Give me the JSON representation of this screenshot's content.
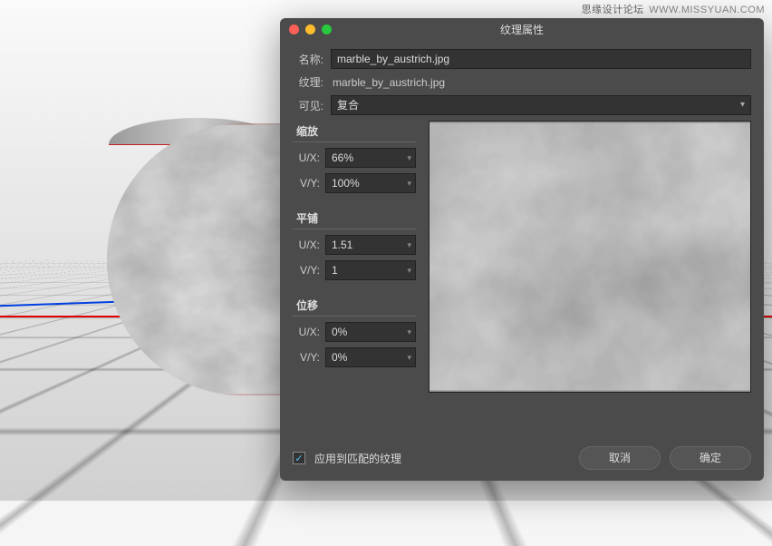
{
  "watermark": {
    "cn": "思缘设计论坛",
    "en": "WWW.MISSYUAN.COM"
  },
  "dialog": {
    "title": "纹理属性",
    "name_label": "名称:",
    "name_value": "marble_by_austrich.jpg",
    "texture_label": "纹理:",
    "texture_value": "marble_by_austrich.jpg",
    "visible_label": "可见:",
    "visible_value": "复合",
    "scale": {
      "title": "缩放",
      "ux_label": "U/X:",
      "ux_value": "66%",
      "vy_label": "V/Y:",
      "vy_value": "100%"
    },
    "tile": {
      "title": "平铺",
      "ux_label": "U/X:",
      "ux_value": "1.51",
      "vy_label": "V/Y:",
      "vy_value": "1"
    },
    "offset": {
      "title": "位移",
      "ux_label": "U/X:",
      "ux_value": "0%",
      "vy_label": "V/Y:",
      "vy_value": "0%"
    },
    "apply_matching_label": "应用到匹配的纹理",
    "apply_matching_checked": true,
    "cancel_label": "取消",
    "ok_label": "确定"
  }
}
